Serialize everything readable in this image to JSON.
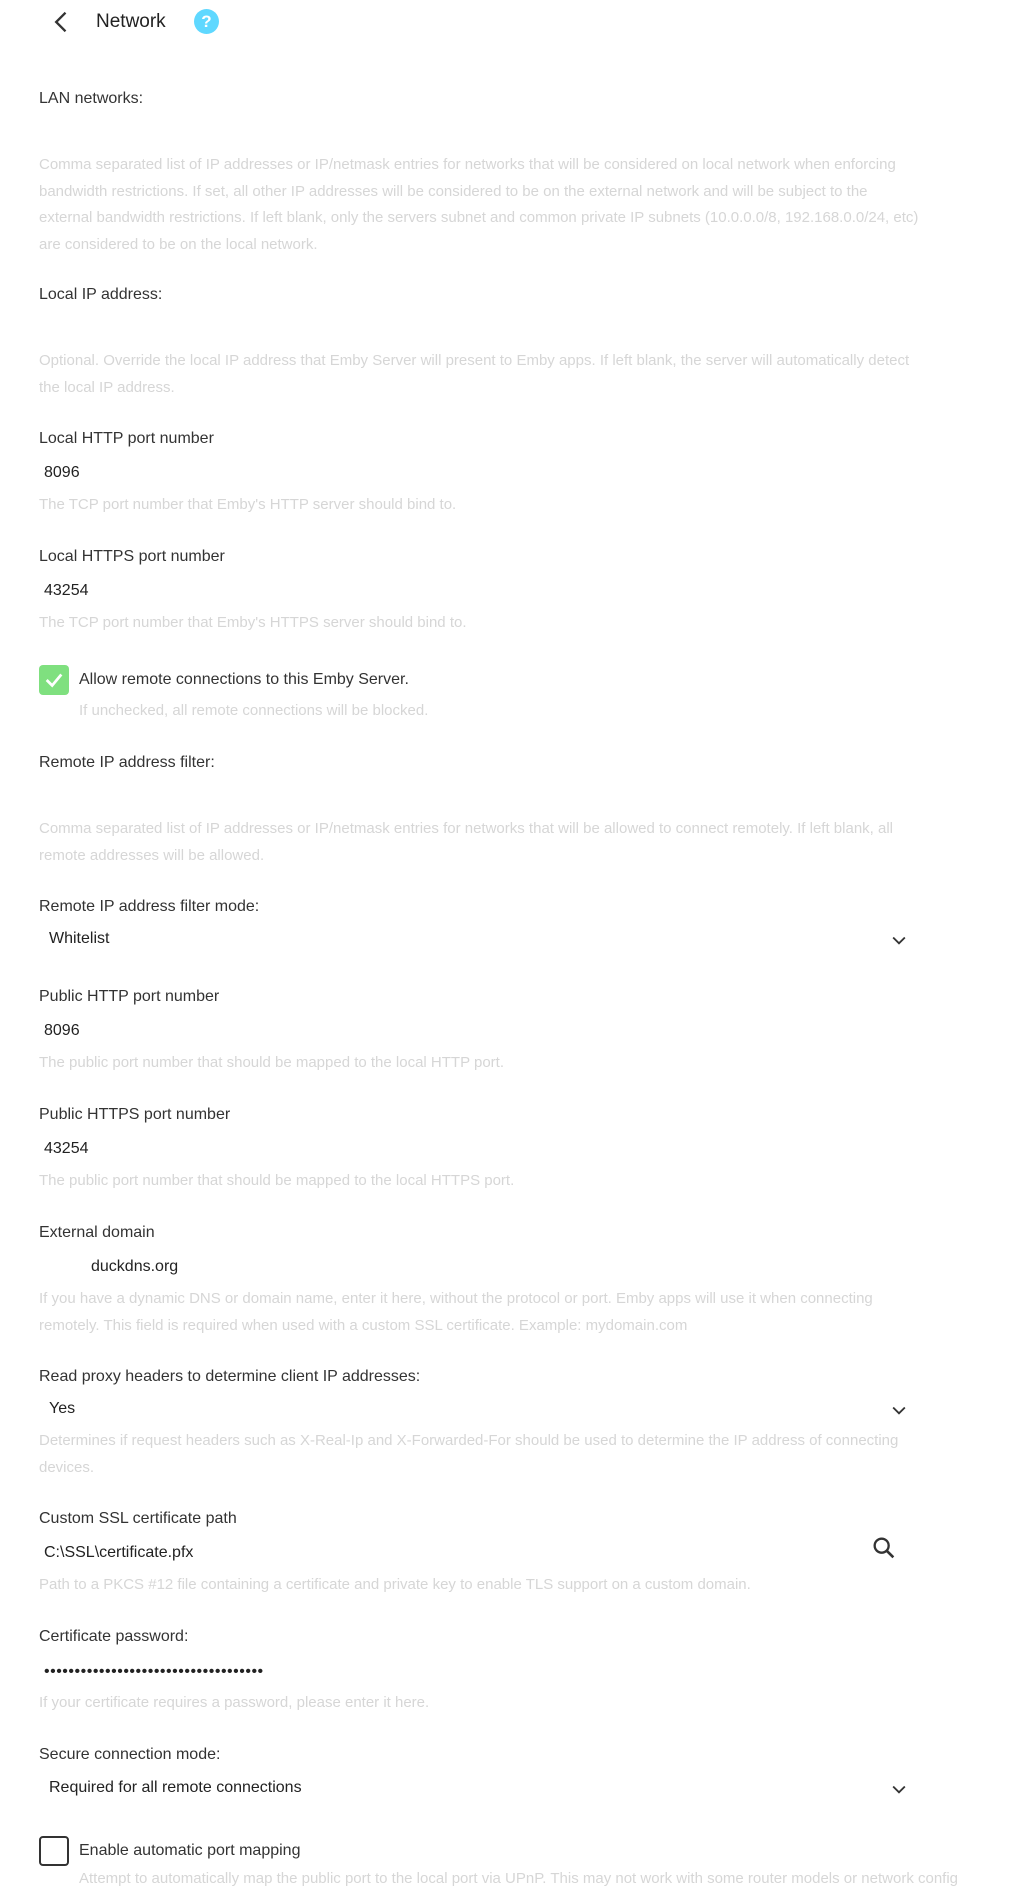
{
  "header": {
    "title": "Network"
  },
  "lan_networks": {
    "label": "LAN networks:",
    "value": "",
    "description": "Comma separated list of IP addresses or IP/netmask entries for networks that will be considered on local network when enforcing bandwidth restrictions. If set, all other IP addresses will be considered to be on the external network and will be subject to the external bandwidth restrictions. If left blank, only the servers subnet and common private IP subnets (10.0.0.0/8, 192.168.0.0/24, etc) are considered to be on the local network."
  },
  "local_ip": {
    "label": "Local IP address:",
    "value": "",
    "description": "Optional. Override the local IP address that Emby Server will present to Emby apps. If left blank, the server will automatically detect the local IP address."
  },
  "local_http_port": {
    "label": "Local HTTP port number",
    "value": "8096",
    "description": "The TCP port number that Emby's HTTP server should bind to."
  },
  "local_https_port": {
    "label": "Local HTTPS port number",
    "value": "43254",
    "description": "The TCP port number that Emby's HTTPS server should bind to."
  },
  "allow_remote": {
    "label": "Allow remote connections to this Emby Server.",
    "checked": true,
    "description": "If unchecked, all remote connections will be blocked."
  },
  "remote_ip_filter": {
    "label": "Remote IP address filter:",
    "value": "",
    "description": "Comma separated list of IP addresses or IP/netmask entries for networks that will be allowed to connect remotely. If left blank, all remote addresses will be allowed."
  },
  "remote_ip_filter_mode": {
    "label": "Remote IP address filter mode:",
    "value": "Whitelist"
  },
  "public_http_port": {
    "label": "Public HTTP port number",
    "value": "8096",
    "description": "The public port number that should be mapped to the local HTTP port."
  },
  "public_https_port": {
    "label": "Public HTTPS port number",
    "value": "43254",
    "description": "The public port number that should be mapped to the local HTTPS port."
  },
  "external_domain": {
    "label": "External domain",
    "value": "duckdns.org",
    "description": "If you have a dynamic DNS or domain name, enter it here, without the protocol or port. Emby apps will use it when connecting remotely. This field is required when used with a custom SSL certificate. Example: mydomain.com"
  },
  "read_proxy_headers": {
    "label": "Read proxy headers to determine client IP addresses:",
    "value": "Yes",
    "description": "Determines if request headers such as X-Real-Ip and X-Forwarded-For should be used to determine the IP address of connecting devices."
  },
  "ssl_cert_path": {
    "label": "Custom SSL certificate path",
    "value": "C:\\SSL\\certificate.pfx",
    "description": "Path to a PKCS #12 file containing a certificate and private key to enable TLS support on a custom domain."
  },
  "cert_password": {
    "label": "Certificate password:",
    "value": "••••••••••••••••••••••••••••••••••••",
    "description": "If your certificate requires a password, please enter it here."
  },
  "secure_connection_mode": {
    "label": "Secure connection mode:",
    "value": "Required for all remote connections"
  },
  "auto_port_mapping": {
    "label": "Enable automatic port mapping",
    "checked": false,
    "description": "Attempt to automatically map the public port to the local port via UPnP. This may not work with some router models or network configurations."
  },
  "colors": {
    "accent": "#7fe07f",
    "help": "#5fd8ff",
    "muted_text": "#d6d6d6"
  }
}
